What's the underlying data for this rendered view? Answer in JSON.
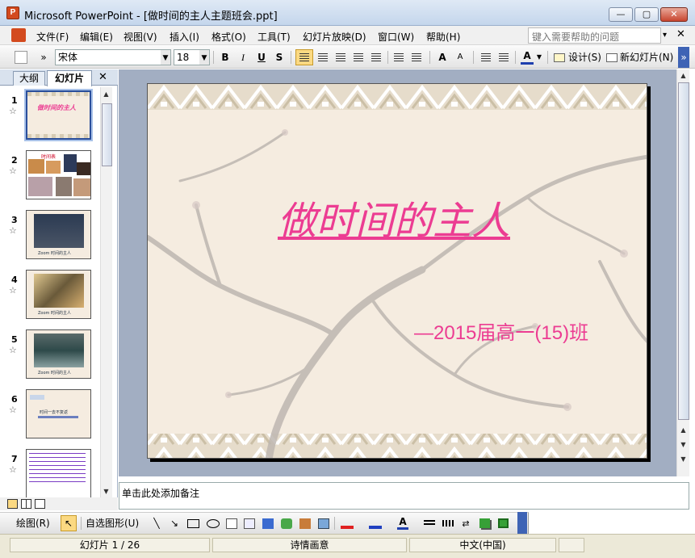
{
  "window": {
    "title": "Microsoft PowerPoint - [做时间的主人主题班会.ppt]",
    "app_icon_label": "P",
    "minimize": "—",
    "maximize": "▢",
    "close": "✕"
  },
  "menubar": {
    "items": [
      "文件(F)",
      "编辑(E)",
      "视图(V)",
      "插入(I)",
      "格式(O)",
      "工具(T)",
      "幻灯片放映(D)",
      "窗口(W)",
      "帮助(H)"
    ],
    "help_placeholder": "键入需要帮助的问题",
    "help_arrow": "▾",
    "close_doc": "✕"
  },
  "toolbar": {
    "font_name": "宋体",
    "font_size": "18",
    "bold": "B",
    "italic": "I",
    "underline": "U",
    "shadow": "S",
    "grow_font": "A",
    "shrink_font": "A",
    "font_color": "A",
    "design_label": "设计(S)",
    "new_slide_label": "新幻灯片(N)",
    "more": "»"
  },
  "left_pane": {
    "tab_outline": "大纲",
    "tab_slides": "幻灯片",
    "close": "✕",
    "slides": [
      {
        "number": "1",
        "caption": "做时间的主人"
      },
      {
        "number": "2",
        "caption": "时间表"
      },
      {
        "number": "3",
        "caption": "Zoom 时间的主人"
      },
      {
        "number": "4",
        "caption": "Zoom 时间的主人"
      },
      {
        "number": "5",
        "caption": "Zoom 时间的主人"
      },
      {
        "number": "6",
        "caption": "时间一去不复返"
      },
      {
        "number": "7",
        "caption": ""
      }
    ]
  },
  "slide": {
    "title": "做时间的主人",
    "subtitle": "—2015届高一(15)班"
  },
  "notes": {
    "placeholder": "单击此处添加备注"
  },
  "drawbar": {
    "draw_label": "绘图(R)",
    "autoshapes_label": "自选图形(U)"
  },
  "statusbar": {
    "slide_position": "幻灯片 1 / 26",
    "design_name": "诗情画意",
    "language": "中文(中国)"
  },
  "colors": {
    "title_pink": "#ec3c92",
    "canvas_bg": "#a2aec2",
    "selection_blue": "#2b4f9b"
  }
}
